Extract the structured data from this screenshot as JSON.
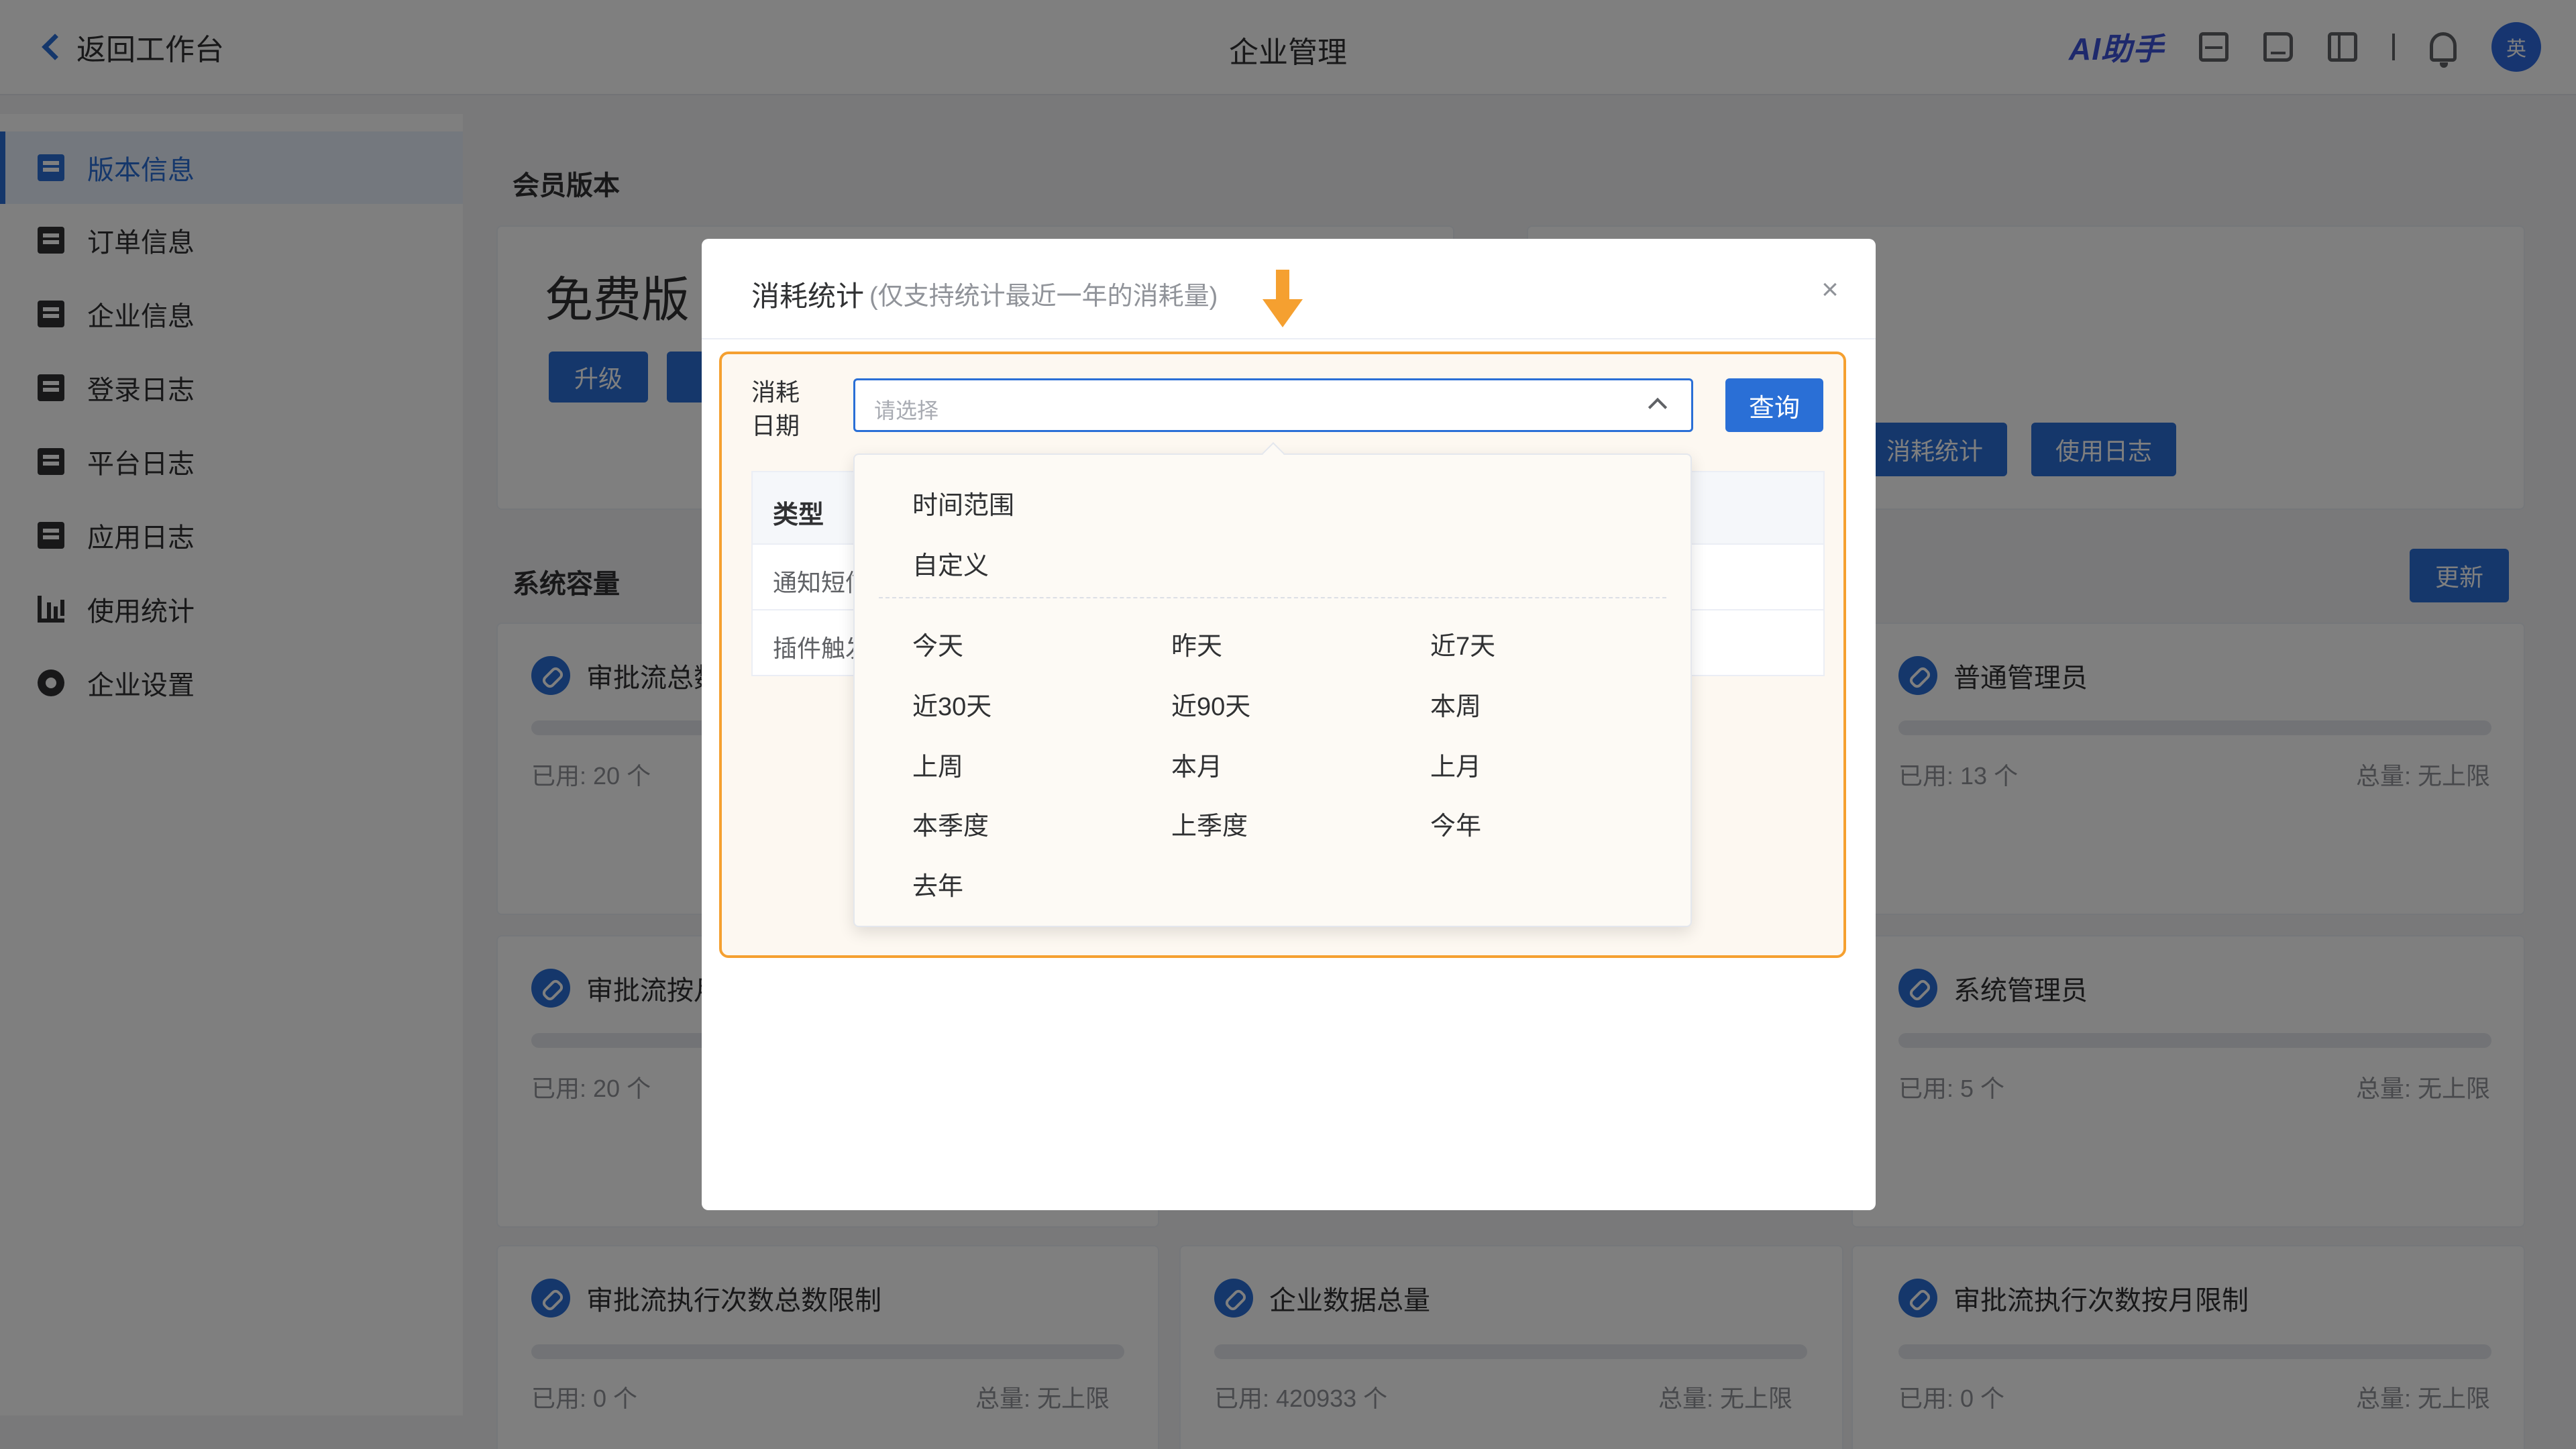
{
  "header": {
    "back_label": "返回工作台",
    "title": "企业管理",
    "ai_label": "AI助手",
    "avatar_text": "英"
  },
  "sidebar": {
    "items": [
      {
        "label": "版本信息",
        "icon": "version-icon",
        "active": true
      },
      {
        "label": "订单信息",
        "icon": "order-icon"
      },
      {
        "label": "企业信息",
        "icon": "building-icon"
      },
      {
        "label": "登录日志",
        "icon": "monitor-icon"
      },
      {
        "label": "平台日志",
        "icon": "log-icon"
      },
      {
        "label": "应用日志",
        "icon": "list-icon"
      },
      {
        "label": "使用统计",
        "icon": "bar-chart-icon"
      },
      {
        "label": "企业设置",
        "icon": "gear-icon"
      }
    ]
  },
  "main": {
    "member_section": "会员版本",
    "edition": "免费版",
    "upgrade_label": "升级",
    "consume_stats_label": "消耗统计",
    "usage_log_label": "使用日志",
    "capacity_section": "系统容量",
    "update_label": "更新",
    "used_prefix": "已用:",
    "total_prefix": "总量:",
    "capacity_cards": [
      {
        "title": "审批流总数",
        "used": "20 个",
        "total": ""
      },
      {
        "title": "普通管理员",
        "used": "13 个",
        "total": "无上限"
      },
      {
        "title": "审批流按月",
        "used": "20 个",
        "total": ""
      },
      {
        "title": "系统管理员",
        "used": "5 个",
        "total": "无上限"
      },
      {
        "title": "审批流执行次数总数限制",
        "used": "0 个",
        "total": "无上限"
      },
      {
        "title": "企业数据总量",
        "used": "420933 个",
        "total": "无上限"
      },
      {
        "title": "审批流执行次数按月限制",
        "used": "0 个",
        "total": "无上限"
      }
    ]
  },
  "modal": {
    "title": "消耗统计",
    "subtitle": "(仅支持统计最近一年的消耗量)",
    "field_label": "消耗日期",
    "select_placeholder": "请选择",
    "query_label": "查询",
    "table": {
      "header": "类型",
      "rows": [
        "通知短信",
        "插件触发"
      ]
    },
    "dropdown": {
      "group_options": [
        "时间范围",
        "自定义"
      ],
      "quick_options": [
        "今天",
        "昨天",
        "近7天",
        "近30天",
        "近90天",
        "本周",
        "上周",
        "本月",
        "上月",
        "本季度",
        "上季度",
        "今年",
        "去年"
      ]
    }
  },
  "colors": {
    "primary": "#2a6fd6",
    "highlight": "#f5a030",
    "overlay": "rgba(0,0,0,0.5)"
  }
}
